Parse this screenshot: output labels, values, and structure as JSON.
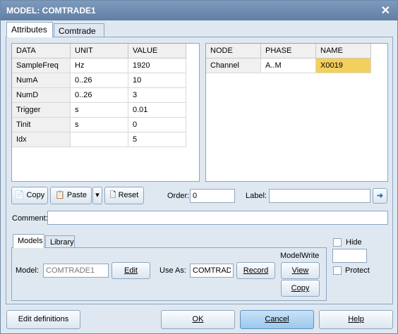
{
  "window": {
    "title": "MODEL: COMTRADE1"
  },
  "tabs": {
    "attributes": "Attributes",
    "comtrade": "Comtrade"
  },
  "left_grid": {
    "headers": [
      "DATA",
      "UNIT",
      "VALUE"
    ],
    "rows": [
      [
        "SampleFreq",
        "Hz",
        "1920"
      ],
      [
        "NumA",
        "0..26",
        "10"
      ],
      [
        "NumD",
        "0..26",
        "3"
      ],
      [
        "Trigger",
        "s",
        "0.01"
      ],
      [
        "Tinit",
        "s",
        "0"
      ],
      [
        "Idx",
        "",
        "5"
      ]
    ]
  },
  "right_grid": {
    "headers": [
      "NODE",
      "PHASE",
      "NAME"
    ],
    "rows": [
      [
        "Channel",
        "A..M",
        "X0019"
      ]
    ]
  },
  "toolbar": {
    "copy": "Copy",
    "paste": "Paste",
    "reset": "Reset",
    "order_label": "Order:",
    "order_value": "0",
    "label_label": "Label:",
    "label_value": ""
  },
  "comment": {
    "label": "Comment:",
    "value": ""
  },
  "bottom_tabs": {
    "models": "Models",
    "library": "Library"
  },
  "models_panel": {
    "model_label": "Model:",
    "model_value": "COMTRADE1",
    "edit": "Edit",
    "use_as_label": "Use As:",
    "use_as_value": "COMTRADE",
    "record": "Record",
    "modelwrite_label": "ModelWrite",
    "view": "View",
    "copy": "Copy"
  },
  "side": {
    "hide": "Hide",
    "protect": "Protect"
  },
  "footer": {
    "edit_definitions": "Edit definitions",
    "ok": "OK",
    "cancel": "Cancel",
    "help": "Help"
  },
  "colors": {
    "selected_cell": "#f3cf5d",
    "titlebar": "#6d8db0"
  }
}
